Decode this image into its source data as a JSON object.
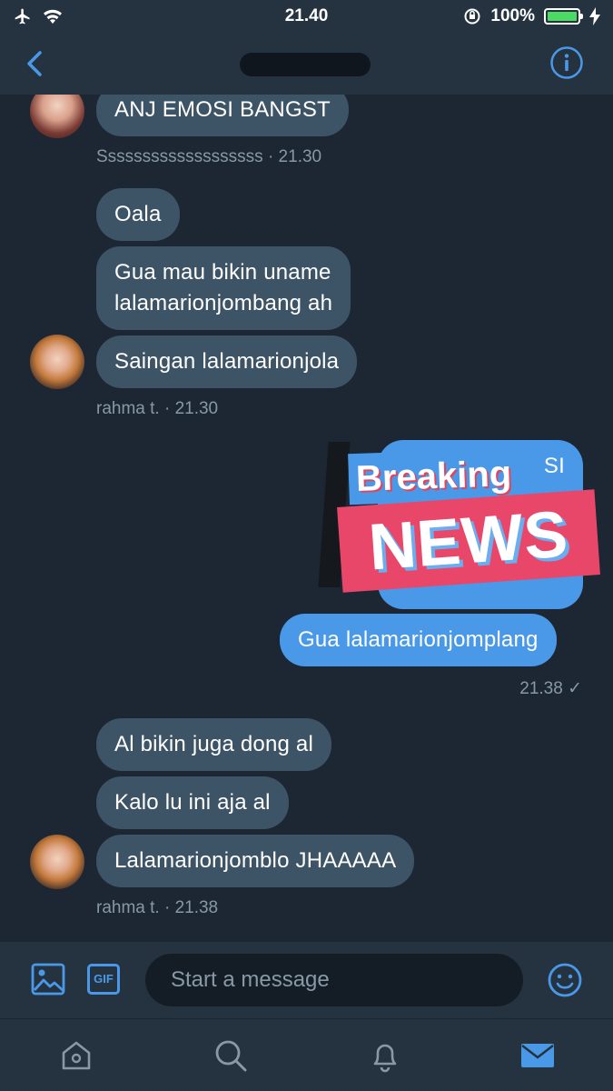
{
  "status_bar": {
    "time": "21.40",
    "battery": "100%"
  },
  "colors": {
    "accent": "#4a99e9",
    "received_bubble": "#3d5466",
    "background": "#1c2733"
  },
  "messages": [
    {
      "text": "ANJ EMOSI BANGST"
    },
    {
      "meta": "Sssssssssssssssssss · 21.30"
    },
    {
      "text": "Oala"
    },
    {
      "text": "Gua mau bikin uname"
    },
    {
      "text": "lalamarionjombang ah"
    },
    {
      "text": "Saingan lalamarionjola"
    },
    {
      "meta": "rahma t. · 21.30"
    },
    {
      "text": "SI"
    },
    {
      "text": "Gua lalamarionjomplang"
    },
    {
      "meta": "21.38 ✓"
    },
    {
      "text": "Al bikin juga dong al"
    },
    {
      "text": "Kalo lu ini aja al"
    },
    {
      "text": "Lalamarionjomblo JHAAAAA"
    },
    {
      "meta": "rahma t. · 21.38"
    }
  ],
  "sticker": {
    "line1": "Breaking",
    "line2": "NEWS"
  },
  "composer": {
    "placeholder": "Start a message",
    "gif_label": "GIF"
  },
  "icons": [
    "airplane-icon",
    "wifi-icon",
    "rotation-lock-icon",
    "battery-icon",
    "charging-icon",
    "back-icon",
    "info-icon",
    "image-icon",
    "emoji-icon",
    "home-icon",
    "search-icon",
    "bell-icon",
    "mail-icon"
  ]
}
